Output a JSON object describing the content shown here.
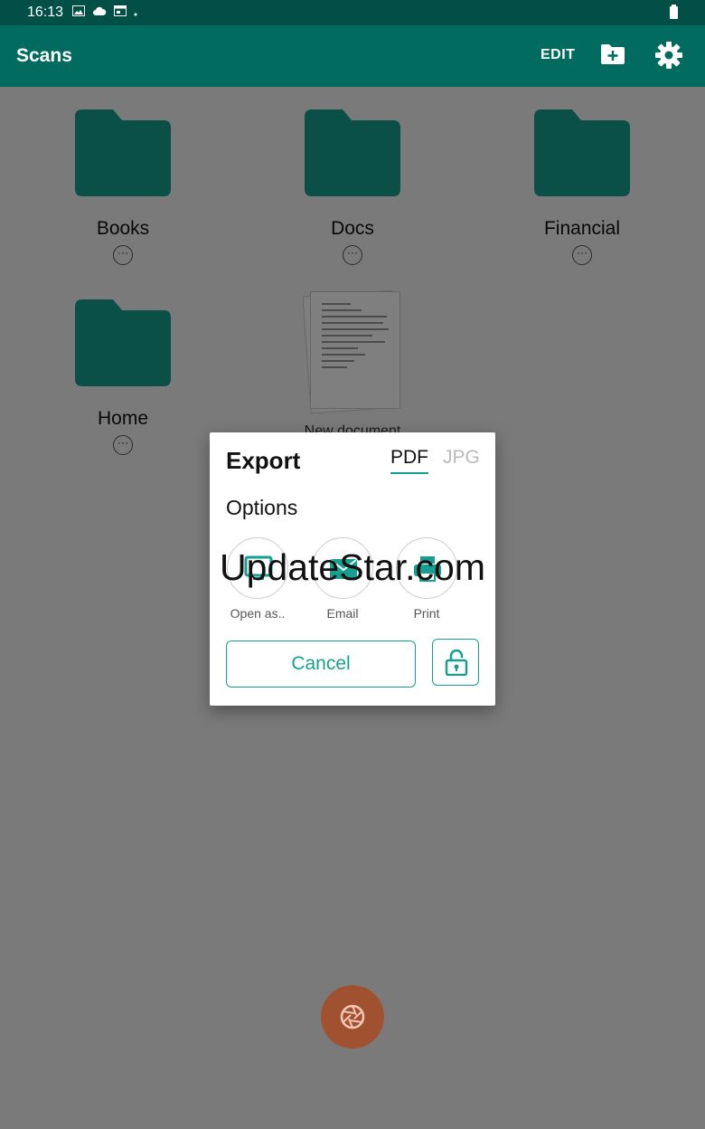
{
  "status_bar": {
    "time": "16:13"
  },
  "app_bar": {
    "title": "Scans",
    "edit_label": "EDIT"
  },
  "folders": [
    {
      "name": "Books"
    },
    {
      "name": "Docs"
    },
    {
      "name": "Financial"
    },
    {
      "name": "Home"
    }
  ],
  "document": {
    "name": "New document"
  },
  "more_glyph": "···",
  "export_dialog": {
    "title": "Export",
    "tabs": [
      {
        "label": "PDF",
        "selected": true
      },
      {
        "label": "JPG",
        "selected": false
      }
    ],
    "options_label": "Options",
    "actions": [
      {
        "label": "Open as.."
      },
      {
        "label": "Email"
      },
      {
        "label": "Print"
      }
    ],
    "cancel_label": "Cancel"
  },
  "watermark": "UpdateStar.com",
  "colors": {
    "primary": "#016b60",
    "status_bar": "#014f46",
    "accent": "#17a08f",
    "shutter": "#e06b3a"
  }
}
